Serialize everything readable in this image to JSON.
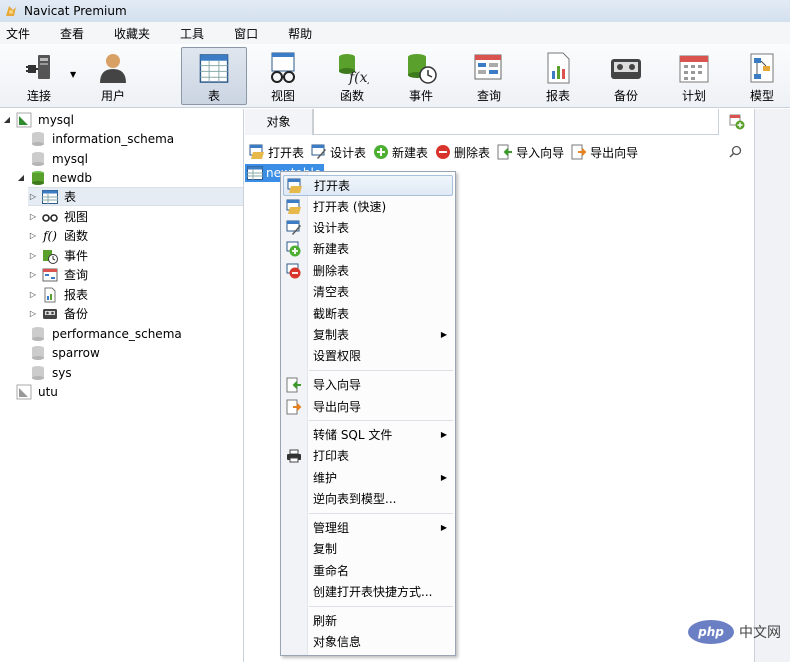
{
  "window": {
    "title": "Navicat Premium"
  },
  "menubar": {
    "items": [
      "文件",
      "查看",
      "收藏夹",
      "工具",
      "窗口",
      "帮助"
    ]
  },
  "toolbar": {
    "buttons": [
      {
        "label": "连接",
        "icon": "connection-icon"
      },
      {
        "label": "用户",
        "icon": "user-icon"
      },
      {
        "label": "表",
        "icon": "table-icon",
        "active": true
      },
      {
        "label": "视图",
        "icon": "view-icon"
      },
      {
        "label": "函数",
        "icon": "function-icon"
      },
      {
        "label": "事件",
        "icon": "event-icon"
      },
      {
        "label": "查询",
        "icon": "query-icon"
      },
      {
        "label": "报表",
        "icon": "report-icon"
      },
      {
        "label": "备份",
        "icon": "backup-icon"
      },
      {
        "label": "计划",
        "icon": "schedule-icon"
      },
      {
        "label": "模型",
        "icon": "model-icon"
      }
    ]
  },
  "sidebar": {
    "tree": [
      {
        "label": "mysql",
        "type": "connection",
        "expanded": true
      },
      {
        "label": "information_schema",
        "type": "database"
      },
      {
        "label": "mysql",
        "type": "database"
      },
      {
        "label": "newdb",
        "type": "database-open",
        "expanded": true
      },
      {
        "label": "表",
        "type": "tables",
        "selected": true
      },
      {
        "label": "视图",
        "type": "views"
      },
      {
        "label": "函数",
        "type": "functions"
      },
      {
        "label": "事件",
        "type": "events"
      },
      {
        "label": "查询",
        "type": "queries"
      },
      {
        "label": "报表",
        "type": "reports"
      },
      {
        "label": "备份",
        "type": "backups"
      },
      {
        "label": "performance_schema",
        "type": "database"
      },
      {
        "label": "sparrow",
        "type": "database"
      },
      {
        "label": "sys",
        "type": "database"
      },
      {
        "label": "utu",
        "type": "connection"
      }
    ]
  },
  "object_panel": {
    "tab_label": "对象",
    "toolbar": [
      {
        "label": "打开表",
        "icon": "open-table-icon"
      },
      {
        "label": "设计表",
        "icon": "design-table-icon"
      },
      {
        "label": "新建表",
        "icon": "new-table-icon"
      },
      {
        "label": "删除表",
        "icon": "delete-table-icon"
      },
      {
        "label": "导入向导",
        "icon": "import-wizard-icon"
      },
      {
        "label": "导出向导",
        "icon": "export-wizard-icon"
      }
    ],
    "selected_item": "newtable"
  },
  "context_menu": {
    "items": [
      {
        "label": "打开表",
        "icon": "open-table",
        "hover": true
      },
      {
        "label": "打开表 (快速)",
        "icon": "open-table-fast"
      },
      {
        "label": "设计表",
        "icon": "design-table"
      },
      {
        "label": "新建表",
        "icon": "new-table"
      },
      {
        "label": "删除表",
        "icon": "delete-table"
      },
      {
        "label": "清空表"
      },
      {
        "label": "截断表"
      },
      {
        "label": "复制表",
        "submenu": true
      },
      {
        "label": "设置权限"
      },
      {
        "separator": true
      },
      {
        "label": "导入向导",
        "icon": "import-wizard"
      },
      {
        "label": "导出向导",
        "icon": "export-wizard"
      },
      {
        "separator": true
      },
      {
        "label": "转储 SQL 文件",
        "submenu": true
      },
      {
        "label": "打印表",
        "icon": "print"
      },
      {
        "label": "维护",
        "submenu": true
      },
      {
        "label": "逆向表到模型..."
      },
      {
        "separator": true
      },
      {
        "label": "管理组",
        "submenu": true
      },
      {
        "label": "复制"
      },
      {
        "label": "重命名"
      },
      {
        "label": "创建打开表快捷方式..."
      },
      {
        "separator": true
      },
      {
        "label": "刷新"
      },
      {
        "label": "对象信息"
      }
    ]
  },
  "watermark": {
    "logo": "php",
    "text": "中文网"
  }
}
